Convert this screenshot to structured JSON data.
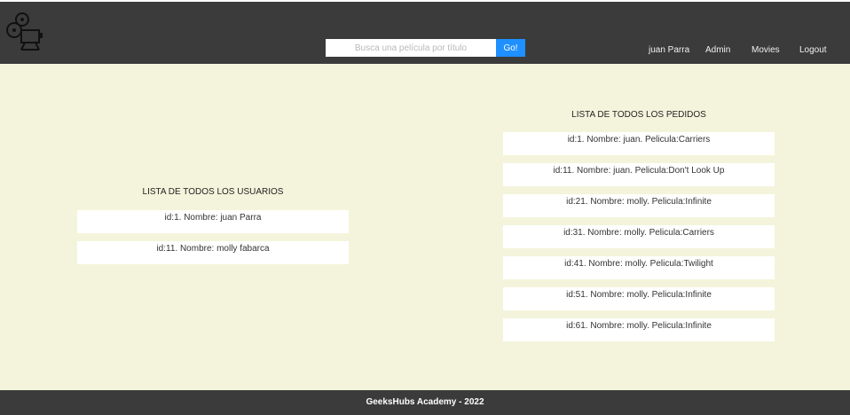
{
  "header": {
    "search": {
      "placeholder": "Busca una película por título",
      "button_label": "Go!"
    },
    "nav": [
      "juan Parra",
      "Admin",
      "Movies",
      "Logout"
    ]
  },
  "users": {
    "title": "LISTA DE TODOS LOS USUARIOS",
    "items": [
      "id:1. Nombre: juan Parra",
      "id:11. Nombre: molly fabarca"
    ]
  },
  "orders": {
    "title": "LISTA DE TODOS LOS PEDIDOS",
    "items": [
      "id:1. Nombre: juan. Pelicula:Carriers",
      "id:11. Nombre: juan. Pelicula:Don't Look Up",
      "id:21. Nombre: molly. Pelicula:Infinite",
      "id:31. Nombre: molly. Pelicula:Carriers",
      "id:41. Nombre: molly. Pelicula:Twilight",
      "id:51. Nombre: molly. Pelicula:Infinite",
      "id:61. Nombre: molly. Pelicula:Infinite"
    ]
  },
  "footer": {
    "text": "GeeksHubs Academy - 2022"
  },
  "colors": {
    "header_bg": "#3b3b3b",
    "page_bg": "#f4f4dc",
    "button_blue": "#1e90ff"
  }
}
